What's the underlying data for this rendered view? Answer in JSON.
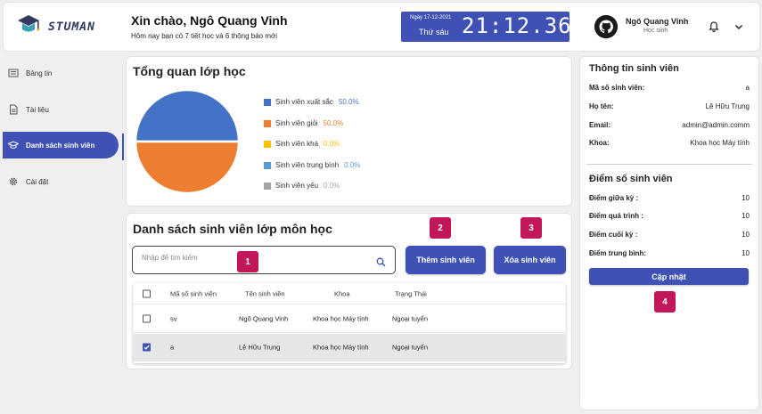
{
  "header": {
    "brand": "STUMAN",
    "greeting": "Xin chào, Ngô Quang Vinh",
    "subtitle": "Hôm nay bạn có 7 tiết học và 6 thông báo mới",
    "date": "Ngày 17-12-2021",
    "weekday": "Thứ sáu",
    "time": "21:12.36",
    "user_name": "Ngô Quang Vinh",
    "user_role": "Học sinh"
  },
  "sidebar": {
    "items": [
      {
        "label": "Bảng tin",
        "icon": "newspaper-icon"
      },
      {
        "label": "Tài liệu",
        "icon": "document-icon"
      },
      {
        "label": "Danh sách sinh viên",
        "icon": "graduation-cap-icon",
        "active": true
      },
      {
        "label": "Cài đặt",
        "icon": "gear-icon"
      }
    ]
  },
  "overview": {
    "title": "Tổng quan lớp học",
    "legend": [
      {
        "label": "Sinh viên xuất sắc",
        "pct": "50.0%",
        "color": "#4472c4"
      },
      {
        "label": "Sinh viên giỏi",
        "pct": "50.0%",
        "color": "#ed7d31"
      },
      {
        "label": "Sinh viên khá",
        "pct": "0.0%",
        "color": "#ffc000"
      },
      {
        "label": "Sinh viên trung bình",
        "pct": "0.0%",
        "color": "#5b9bd5"
      },
      {
        "label": "Sinh viên yếu",
        "pct": "0.0%",
        "color": "#a5a5a5"
      }
    ]
  },
  "chart_data": {
    "type": "pie",
    "categories": [
      "Sinh viên xuất sắc",
      "Sinh viên giỏi",
      "Sinh viên khá",
      "Sinh viên trung bình",
      "Sinh viên yếu"
    ],
    "values": [
      50.0,
      50.0,
      0.0,
      0.0,
      0.0
    ]
  },
  "student_list": {
    "title": "Danh sách sinh viên lớp môn học",
    "search_placeholder": "Nhập để tìm kiếm",
    "add_button": "Thêm sinh viên",
    "delete_button": "Xóa sinh viên",
    "columns": [
      "Mã số sinh viên",
      "Tên sinh viên",
      "Khoa",
      "Trạng Thái"
    ],
    "rows": [
      {
        "id": "sv",
        "name": "Ngô Quang Vinh",
        "faculty": "Khoa học Máy tính",
        "status": "Ngoại tuyến",
        "checked": false
      },
      {
        "id": "a",
        "name": "Lê Hữu Trung",
        "faculty": "Khoa học Máy tính",
        "status": "Ngoại tuyến",
        "checked": true
      }
    ]
  },
  "student_info": {
    "title": "Thông tin sinh viên",
    "fields": [
      {
        "label": "Mã số sinh viên:",
        "value": "a"
      },
      {
        "label": "Họ tên:",
        "value": "Lê Hữu Trung"
      },
      {
        "label": "Email:",
        "value": "admin@admin.comm"
      },
      {
        "label": "Khoa:",
        "value": "Khoa học Máy tính"
      }
    ]
  },
  "scores": {
    "title": "Điểm số sinh viên",
    "fields": [
      {
        "label": "Điểm giữa kỳ :",
        "value": "10"
      },
      {
        "label": "Điểm quá trình :",
        "value": "10"
      },
      {
        "label": "Điểm cuối kỳ :",
        "value": "10"
      },
      {
        "label": "Điểm trung bình:",
        "value": "10"
      }
    ],
    "update_button": "Cập nhật"
  },
  "markers": [
    "1",
    "2",
    "3",
    "4"
  ],
  "colors": {
    "accent": "#3f51b5",
    "marker": "#c2185b"
  }
}
